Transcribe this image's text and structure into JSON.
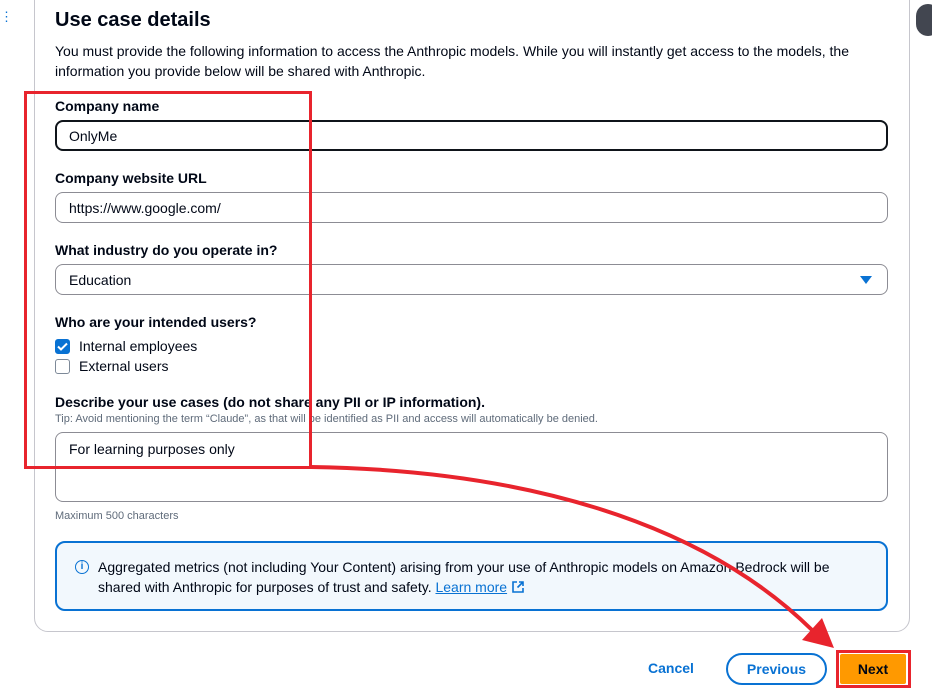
{
  "section": {
    "title": "Use case details",
    "description": "You must provide the following information to access the Anthropic models. While you will instantly get access to the models, the information you provide below will be shared with Anthropic."
  },
  "company_name": {
    "label": "Company name",
    "value": "OnlyMe"
  },
  "company_website": {
    "label": "Company website URL",
    "value": "https://www.google.com/"
  },
  "industry": {
    "label": "What industry do you operate in?",
    "selected": "Education"
  },
  "intended_users": {
    "label": "Who are your intended users?",
    "options": [
      {
        "label": "Internal employees",
        "checked": true
      },
      {
        "label": "External users",
        "checked": false
      }
    ]
  },
  "use_cases": {
    "label": "Describe your use cases (do not share any PII or IP information).",
    "tip": "Tip: Avoid mentioning the term “Claude”, as that will be identified as PII and access will automatically be denied.",
    "value": "For learning purposes only",
    "constraint": "Maximum 500 characters"
  },
  "info": {
    "text": "Aggregated metrics (not including Your Content) arising from your use of Anthropic models on Amazon Bedrock will be shared with Anthropic for purposes of trust and safety.",
    "link": "Learn more"
  },
  "actions": {
    "cancel": "Cancel",
    "previous": "Previous",
    "next": "Next"
  },
  "colors": {
    "accent": "#0972d3",
    "primary_button": "#ff9900",
    "annotation": "#e8242d"
  },
  "icons": {
    "info": "info-icon",
    "external_link": "external-link-icon",
    "dropdown": "caret-down-icon",
    "checkbox": "check-icon"
  }
}
